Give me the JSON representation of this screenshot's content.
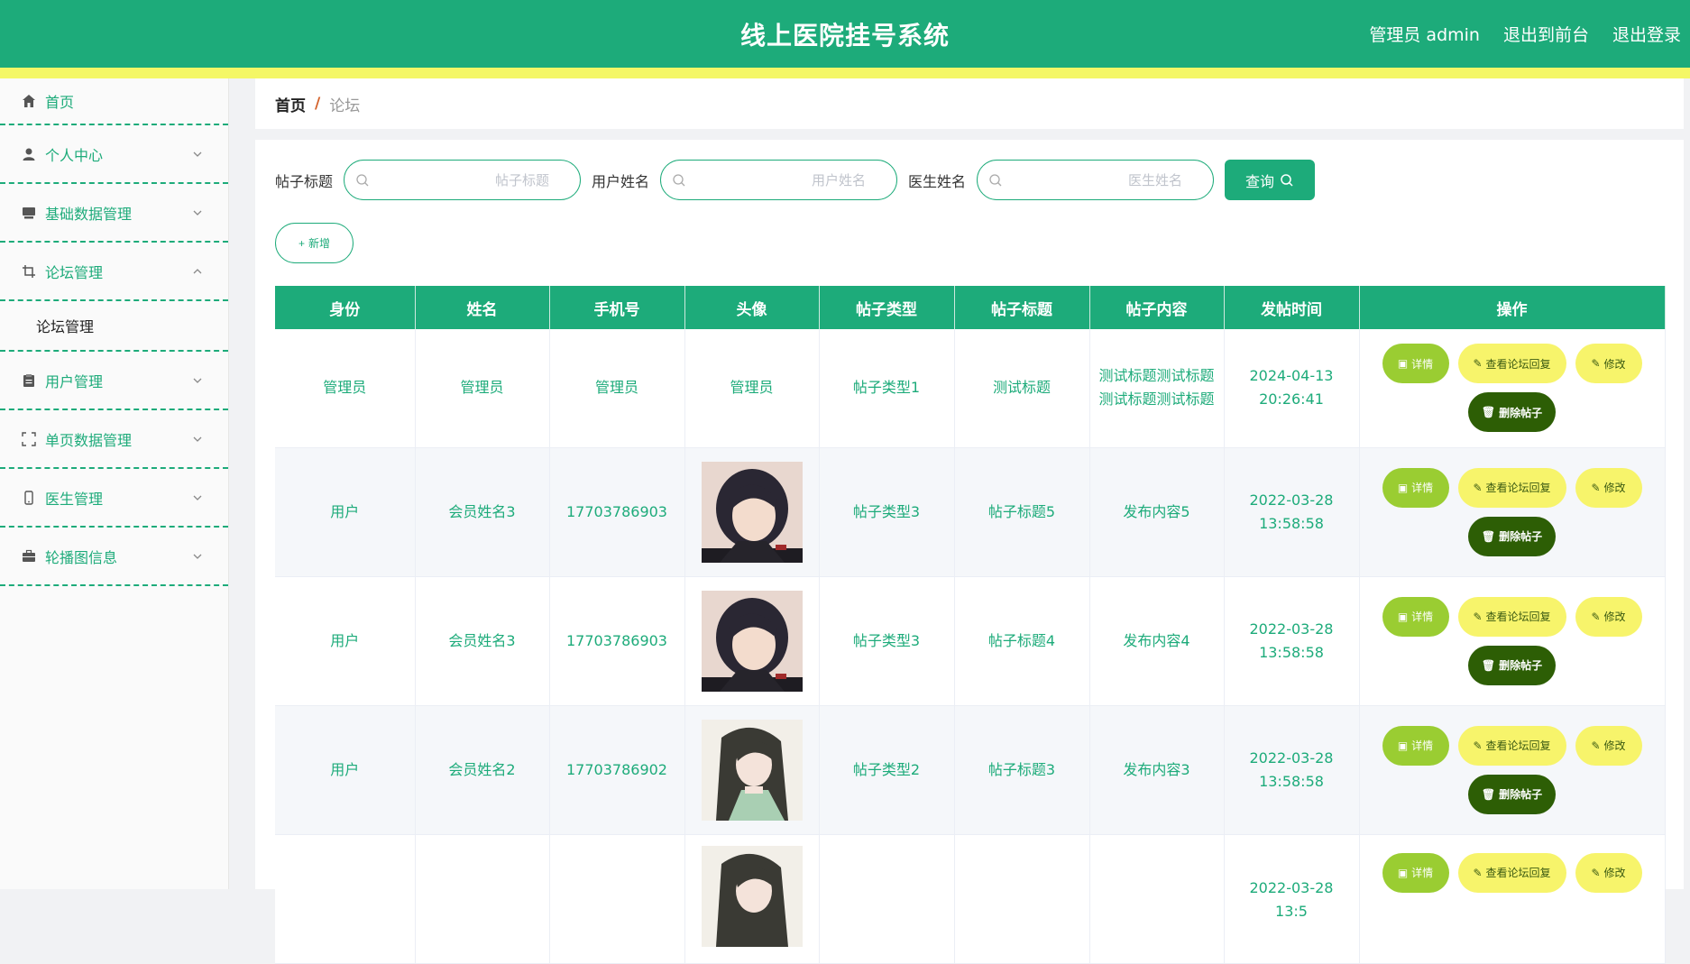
{
  "header": {
    "title": "线上医院挂号系统",
    "admin_label": "管理员 admin",
    "to_front_label": "退出到前台",
    "logout_label": "退出登录"
  },
  "sidebar": {
    "items": [
      {
        "label": "首页",
        "icon": "home-icon"
      },
      {
        "label": "个人中心",
        "icon": "user-icon"
      },
      {
        "label": "基础数据管理",
        "icon": "monitor-icon"
      },
      {
        "label": "论坛管理",
        "icon": "crop-icon",
        "expanded": true,
        "children": [
          "论坛管理"
        ]
      },
      {
        "label": "用户管理",
        "icon": "clipboard-icon"
      },
      {
        "label": "单页数据管理",
        "icon": "fullscreen-icon"
      },
      {
        "label": "医生管理",
        "icon": "mobile-icon"
      },
      {
        "label": "轮播图信息",
        "icon": "briefcase-icon"
      }
    ]
  },
  "breadcrumb": {
    "home": "首页",
    "separator": "/",
    "current": "论坛"
  },
  "search": {
    "title_label": "帖子标题",
    "title_placeholder": "帖子标题",
    "user_label": "用户姓名",
    "user_placeholder": "用户姓名",
    "doctor_label": "医生姓名",
    "doctor_placeholder": "医生姓名",
    "query_button": "查询"
  },
  "add_button": "新增",
  "table": {
    "columns": [
      "身份",
      "姓名",
      "手机号",
      "头像",
      "帖子类型",
      "帖子标题",
      "帖子内容",
      "发帖时间",
      "操作"
    ],
    "rows": [
      {
        "role": "管理员",
        "name": "管理员",
        "phone": "管理员",
        "avatar": "管理员",
        "type": "帖子类型1",
        "title": "测试标题",
        "content": "测试标题测试标题测试标题测试标题",
        "time": "2024-04-13 20:26:41"
      },
      {
        "role": "用户",
        "name": "会员姓名3",
        "phone": "17703786903",
        "avatar": "image",
        "type": "帖子类型3",
        "title": "帖子标题5",
        "content": "发布内容5",
        "time": "2022-03-28 13:58:58"
      },
      {
        "role": "用户",
        "name": "会员姓名3",
        "phone": "17703786903",
        "avatar": "image",
        "type": "帖子类型3",
        "title": "帖子标题4",
        "content": "发布内容4",
        "time": "2022-03-28 13:58:58"
      },
      {
        "role": "用户",
        "name": "会员姓名2",
        "phone": "17703786902",
        "avatar": "image",
        "type": "帖子类型2",
        "title": "帖子标题3",
        "content": "发布内容3",
        "time": "2022-03-28 13:58:58"
      },
      {
        "role": "",
        "name": "",
        "phone": "",
        "avatar": "image",
        "type": "",
        "title": "",
        "content": "",
        "time": "2022-03-28 13:5"
      }
    ],
    "actions": {
      "detail": "详情",
      "view_reply": "查看论坛回复",
      "edit": "修改",
      "delete": "删除帖子"
    }
  },
  "colors": {
    "primary": "#1dab7a",
    "stripe": "#f4f766",
    "detail": "#9acd32",
    "yellow": "#f7f46b",
    "delete": "#2d5e05"
  }
}
